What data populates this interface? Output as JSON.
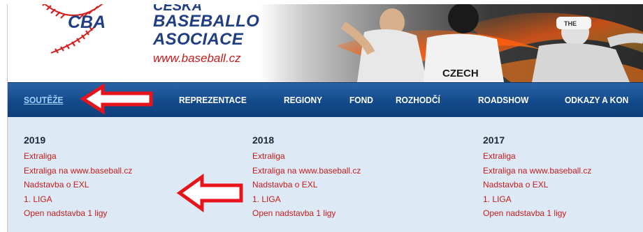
{
  "brand": {
    "top_fragment": "ČESKÁ",
    "line1": "BASEBALLOVÁ",
    "line2": "ASOCIACE",
    "url": "www.baseball.cz",
    "logo_text": "CBA"
  },
  "photo": {
    "jersey_text": "CZECH",
    "cap_text": "THE"
  },
  "nav": {
    "items": [
      {
        "label": "SOUTĚŽE",
        "active": true
      },
      {
        "label": "REPREZENTACE"
      },
      {
        "label": "REGIONY"
      },
      {
        "label": "FOND"
      },
      {
        "label": "ROZHODČÍ"
      },
      {
        "label": "ROADSHOW"
      },
      {
        "label": "ODKAZY A KON"
      }
    ]
  },
  "columns": [
    {
      "year": "2019",
      "links": [
        "Extraliga",
        "Extraliga na www.baseball.cz",
        "Nadstavba o EXL",
        "1. LIGA",
        "Open nadstavba 1 ligy"
      ]
    },
    {
      "year": "2018",
      "links": [
        "Extraliga",
        "Extraliga na www.baseball.cz",
        "Nadstavba o EXL",
        "1. LIGA",
        "Open nadstavba 1 ligy"
      ]
    },
    {
      "year": "2017",
      "links": [
        "Extraliga",
        "Extraliga na www.baseball.cz",
        "Nadstavba o EXL",
        "1. LIGA",
        "Open nadstavba 1 ligy"
      ]
    }
  ],
  "colors": {
    "brand_blue": "#1f3e84",
    "link_red": "#c41c1c",
    "nav_blue": "#134a8c",
    "content_bg": "#dde9f5",
    "annotation_red": "#e8141c"
  },
  "annotations": [
    "red-arrow-pointing-at-soutěže",
    "red-arrow-pointing-at-nadstavba-o-exl"
  ]
}
